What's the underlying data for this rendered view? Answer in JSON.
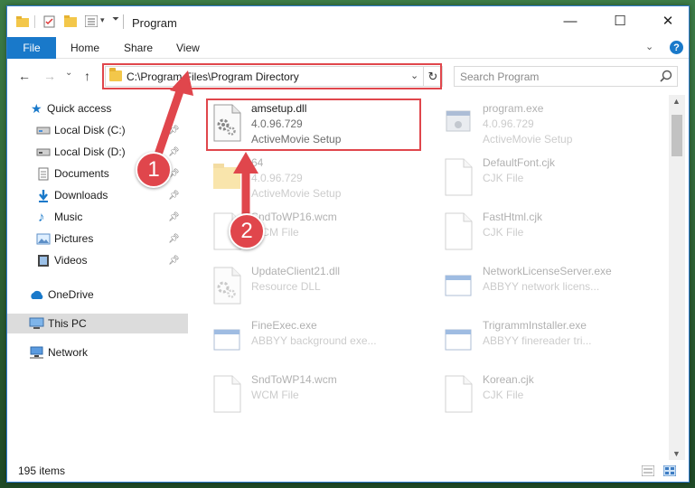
{
  "window": {
    "title": "Program",
    "minimize_glyph": "—",
    "maximize_glyph": "☐",
    "close_glyph": "✕"
  },
  "ribbon": {
    "file_tab": "File",
    "tabs": [
      "Home",
      "Share",
      "View"
    ],
    "expand_glyph": "⌄",
    "help_glyph": "?"
  },
  "nav": {
    "back_glyph": "←",
    "forward_glyph": "→",
    "recent_glyph": "⌄",
    "up_glyph": "↑",
    "address": "C:\\Program Files\\Program Directory",
    "address_chevron": "⌄",
    "refresh_glyph": "↻",
    "search_placeholder": "Search Program"
  },
  "sidebar": {
    "items": [
      {
        "label": "Quick access",
        "icon": "star-icon",
        "pinned": false
      },
      {
        "label": "Local Disk (C:)",
        "icon": "drive-icon",
        "pinned": true
      },
      {
        "label": "Local Disk (D:)",
        "icon": "drive-icon",
        "pinned": true
      },
      {
        "label": "Documents",
        "icon": "documents-icon",
        "pinned": true
      },
      {
        "label": "Downloads",
        "icon": "download-icon",
        "pinned": true
      },
      {
        "label": "Music",
        "icon": "music-icon",
        "pinned": true
      },
      {
        "label": "Pictures",
        "icon": "pictures-icon",
        "pinned": true
      },
      {
        "label": "Videos",
        "icon": "videos-icon",
        "pinned": true
      },
      {
        "label": "OneDrive",
        "icon": "cloud-icon",
        "pinned": false
      },
      {
        "label": "This PC",
        "icon": "computer-icon",
        "pinned": false,
        "selected": true
      },
      {
        "label": "Network",
        "icon": "network-icon",
        "pinned": false
      }
    ]
  },
  "files": [
    {
      "name": "amsetup.dll",
      "line1": "4.0.96.729",
      "line2": "ActiveMovie Setup",
      "icon": "gear-file-icon",
      "highlighted": true
    },
    {
      "name": "program.exe",
      "line1": "4.0.96.729",
      "line2": "ActiveMovie Setup",
      "icon": "exe-icon"
    },
    {
      "name": "64",
      "line1": "4.0.96.729",
      "line2": "ActiveMovie Setup",
      "icon": "folder-icon"
    },
    {
      "name": "DefaultFont.cjk",
      "line1": "CJK File",
      "line2": "",
      "icon": "blank-file-icon"
    },
    {
      "name": "SndToWP16.wcm",
      "line1": "WCM File",
      "line2": "",
      "icon": "blank-file-icon"
    },
    {
      "name": "FastHtml.cjk",
      "line1": "CJK File",
      "line2": "",
      "icon": "blank-file-icon"
    },
    {
      "name": "UpdateClient21.dll",
      "line1": "Resource DLL",
      "line2": "",
      "icon": "gear-file-icon"
    },
    {
      "name": "NetworkLicenseServer.exe",
      "line1": "ABBYY network licens...",
      "line2": "",
      "icon": "window-exe-icon"
    },
    {
      "name": "FineExec.exe",
      "line1": "ABBYY background exe...",
      "line2": "",
      "icon": "window-exe-icon"
    },
    {
      "name": "TrigrammInstaller.exe",
      "line1": "ABBYY finereader tri...",
      "line2": "",
      "icon": "window-exe-icon"
    },
    {
      "name": "SndToWP14.wcm",
      "line1": "WCM File",
      "line2": "",
      "icon": "blank-file-icon"
    },
    {
      "name": "Korean.cjk",
      "line1": "CJK File",
      "line2": "",
      "icon": "blank-file-icon"
    }
  ],
  "status": {
    "item_count": "195 items"
  },
  "annotations": {
    "step1": "1",
    "step2": "2"
  },
  "colors": {
    "accent": "#1979ca",
    "highlight": "#e0464c"
  }
}
